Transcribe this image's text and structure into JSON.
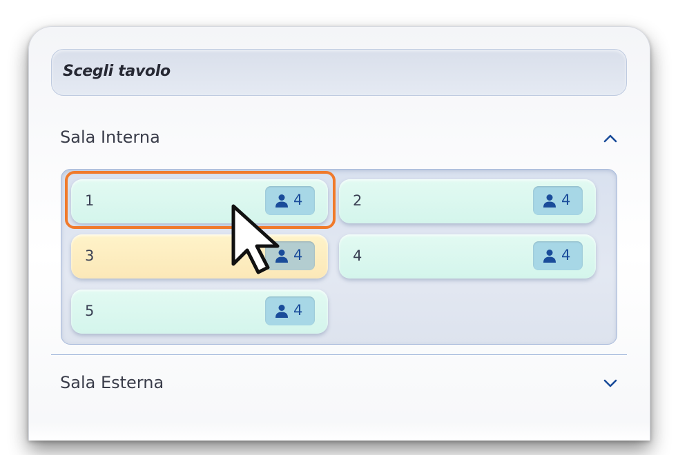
{
  "panel": {
    "title": "Scegli tavolo"
  },
  "sections": [
    {
      "label": "Sala Interna",
      "expanded": true,
      "chevron_icon": "chevron-up-icon",
      "tables": [
        {
          "number": "1",
          "seats": "4",
          "status": "free",
          "highlighted": true
        },
        {
          "number": "2",
          "seats": "4",
          "status": "free"
        },
        {
          "number": "3",
          "seats": "4",
          "status": "occupied"
        },
        {
          "number": "4",
          "seats": "4",
          "status": "free"
        },
        {
          "number": "5",
          "seats": "4",
          "status": "free"
        }
      ]
    },
    {
      "label": "Sala Esterna",
      "expanded": false,
      "chevron_icon": "chevron-down-icon"
    }
  ],
  "icons": {
    "seat_icon": "person-icon",
    "cursor": "mouse-pointer-icon"
  },
  "colors": {
    "free_table": "#d8f6ee",
    "occupied_table": "#fdf0c4",
    "seat_badge": "#a7d7e6",
    "seat_text": "#1a4c9a",
    "accent": "#1a4c9a",
    "highlight": "#f07a2b"
  }
}
